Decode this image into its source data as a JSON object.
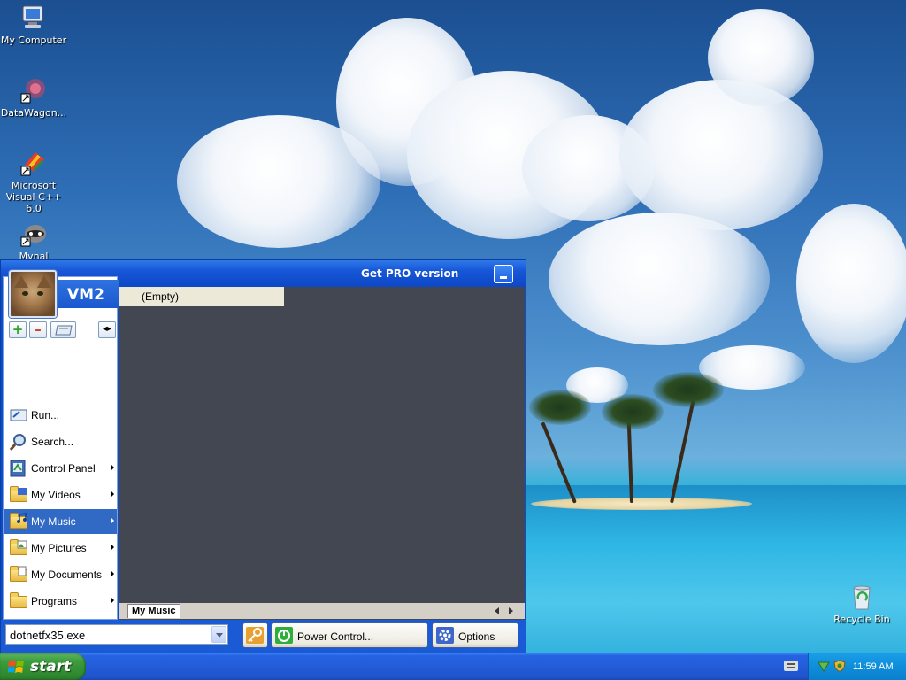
{
  "desktop": {
    "icons": [
      {
        "label": "My Computer"
      },
      {
        "label": "DataWagon..."
      },
      {
        "label": "Microsoft Visual C++ 6.0"
      },
      {
        "label": "Mynal"
      },
      {
        "label": "Recycle Bin"
      }
    ]
  },
  "menu": {
    "promo": "Get PRO version",
    "profile_name": "VM2",
    "toolbar": {
      "add": "+",
      "remove": "–"
    },
    "items": [
      {
        "label": "Run...",
        "icon": "run-icon",
        "submenu": false
      },
      {
        "label": "Search...",
        "icon": "search-icon",
        "submenu": false
      },
      {
        "label": "Control Panel",
        "icon": "control-panel-icon",
        "submenu": true
      },
      {
        "label": "My Videos",
        "icon": "my-videos-icon",
        "submenu": true
      },
      {
        "label": "My Music",
        "icon": "my-music-icon",
        "submenu": true,
        "selected": true
      },
      {
        "label": "My Pictures",
        "icon": "my-pictures-icon",
        "submenu": true
      },
      {
        "label": "My Documents",
        "icon": "my-documents-icon",
        "submenu": true
      },
      {
        "label": "Programs",
        "icon": "programs-folder-icon",
        "submenu": true
      }
    ],
    "submenu_empty": "(Empty)",
    "active_tab": "My Music",
    "run_value": "dotnetfx35.exe",
    "power_label": "Power Control...",
    "options_label": "Options"
  },
  "taskbar": {
    "start_label": "start",
    "clock": "11:59 AM"
  },
  "colors": {
    "selection": "#316ac5",
    "menu_frame": "#0d4dc9",
    "dark_pane": "#434751",
    "start_green": "#3c9c3c",
    "tray_blue": "#0f8ed8"
  }
}
